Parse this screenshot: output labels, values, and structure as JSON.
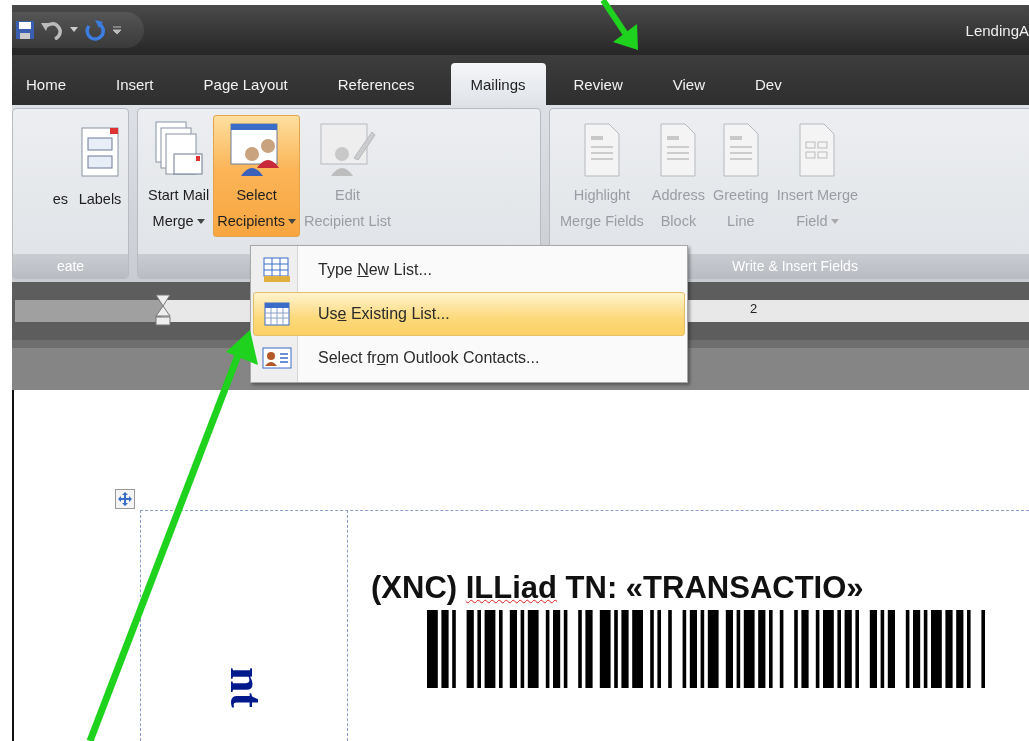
{
  "title_bar": {
    "title": "LendingA"
  },
  "tabs": [
    {
      "label": "Home",
      "selected": false
    },
    {
      "label": "Insert",
      "selected": false
    },
    {
      "label": "Page Layout",
      "selected": false
    },
    {
      "label": "References",
      "selected": false
    },
    {
      "label": "Mailings",
      "selected": true
    },
    {
      "label": "Review",
      "selected": false
    },
    {
      "label": "View",
      "selected": false
    },
    {
      "label": "Dev",
      "selected": false
    }
  ],
  "ribbon_groups": [
    {
      "label": "eate",
      "buttons": [
        {
          "kind": "clipped",
          "line1": "es",
          "dropdown": false,
          "disabled": false,
          "pressed": false
        },
        {
          "kind": "labels",
          "line1": "Labels",
          "dropdown": false,
          "disabled": false,
          "pressed": false
        }
      ]
    },
    {
      "buttons": [
        {
          "kind": "startmerge",
          "line1": "Start Mail",
          "line2": "Merge",
          "dropdown": true,
          "disabled": false,
          "pressed": false
        },
        {
          "kind": "recipients",
          "line1": "Select",
          "line2": "Recipients",
          "dropdown": true,
          "disabled": false,
          "pressed": true
        },
        {
          "kind": "editlist",
          "line1": "Edit",
          "line2": "Recipient List",
          "dropdown": false,
          "disabled": true,
          "pressed": false
        }
      ]
    },
    {
      "label": "Write & Insert Fields",
      "buttons": [
        {
          "kind": "doc",
          "line1": "Highlight",
          "line2": "Merge Fields",
          "dropdown": false,
          "disabled": true,
          "pressed": false
        },
        {
          "kind": "doc",
          "line1": "Address",
          "line2": "Block",
          "dropdown": false,
          "disabled": true,
          "pressed": false
        },
        {
          "kind": "doc",
          "line1": "Greeting",
          "line2": "Line",
          "dropdown": false,
          "disabled": true,
          "pressed": false
        },
        {
          "kind": "grid",
          "line1": "Insert Merge",
          "line2": "Field",
          "dropdown": true,
          "disabled": true,
          "pressed": false
        }
      ]
    }
  ],
  "menu": {
    "items": [
      {
        "kind": "table",
        "before": "Type ",
        "key": "N",
        "after": "ew List...",
        "selected": false
      },
      {
        "kind": "grid",
        "before": "Us",
        "key": "e",
        "after": " Existing List...",
        "selected": true
      },
      {
        "kind": "contact",
        "before": "Select fr",
        "key": "o",
        "after": "m Outlook Contacts...",
        "selected": false
      }
    ]
  },
  "ruler": {
    "labels": [
      "2"
    ]
  },
  "document": {
    "label_parts": [
      {
        "text": "(XNC) ",
        "misspelled": false
      },
      {
        "text": "ILLiad",
        "misspelled": true
      },
      {
        "text": " TN: «TRANSACTIO»",
        "misspelled": false
      }
    ],
    "side_text": "nt"
  }
}
